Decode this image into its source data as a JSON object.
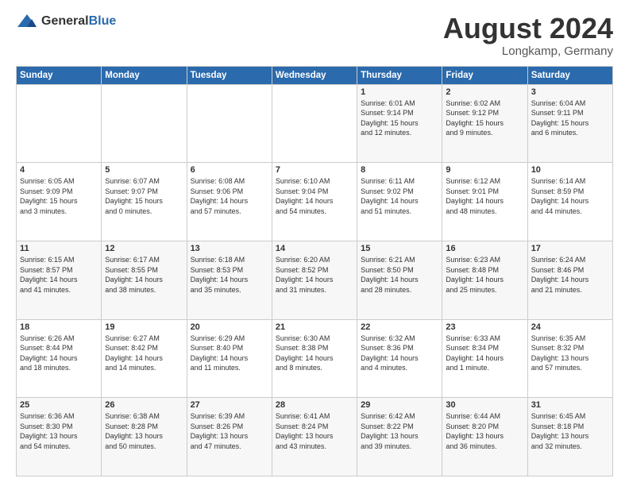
{
  "header": {
    "logo": {
      "general": "General",
      "blue": "Blue"
    },
    "title": "August 2024",
    "location": "Longkamp, Germany"
  },
  "weekdays": [
    "Sunday",
    "Monday",
    "Tuesday",
    "Wednesday",
    "Thursday",
    "Friday",
    "Saturday"
  ],
  "weeks": [
    [
      {
        "day": "",
        "info": ""
      },
      {
        "day": "",
        "info": ""
      },
      {
        "day": "",
        "info": ""
      },
      {
        "day": "",
        "info": ""
      },
      {
        "day": "1",
        "info": "Sunrise: 6:01 AM\nSunset: 9:14 PM\nDaylight: 15 hours\nand 12 minutes."
      },
      {
        "day": "2",
        "info": "Sunrise: 6:02 AM\nSunset: 9:12 PM\nDaylight: 15 hours\nand 9 minutes."
      },
      {
        "day": "3",
        "info": "Sunrise: 6:04 AM\nSunset: 9:11 PM\nDaylight: 15 hours\nand 6 minutes."
      }
    ],
    [
      {
        "day": "4",
        "info": "Sunrise: 6:05 AM\nSunset: 9:09 PM\nDaylight: 15 hours\nand 3 minutes."
      },
      {
        "day": "5",
        "info": "Sunrise: 6:07 AM\nSunset: 9:07 PM\nDaylight: 15 hours\nand 0 minutes."
      },
      {
        "day": "6",
        "info": "Sunrise: 6:08 AM\nSunset: 9:06 PM\nDaylight: 14 hours\nand 57 minutes."
      },
      {
        "day": "7",
        "info": "Sunrise: 6:10 AM\nSunset: 9:04 PM\nDaylight: 14 hours\nand 54 minutes."
      },
      {
        "day": "8",
        "info": "Sunrise: 6:11 AM\nSunset: 9:02 PM\nDaylight: 14 hours\nand 51 minutes."
      },
      {
        "day": "9",
        "info": "Sunrise: 6:12 AM\nSunset: 9:01 PM\nDaylight: 14 hours\nand 48 minutes."
      },
      {
        "day": "10",
        "info": "Sunrise: 6:14 AM\nSunset: 8:59 PM\nDaylight: 14 hours\nand 44 minutes."
      }
    ],
    [
      {
        "day": "11",
        "info": "Sunrise: 6:15 AM\nSunset: 8:57 PM\nDaylight: 14 hours\nand 41 minutes."
      },
      {
        "day": "12",
        "info": "Sunrise: 6:17 AM\nSunset: 8:55 PM\nDaylight: 14 hours\nand 38 minutes."
      },
      {
        "day": "13",
        "info": "Sunrise: 6:18 AM\nSunset: 8:53 PM\nDaylight: 14 hours\nand 35 minutes."
      },
      {
        "day": "14",
        "info": "Sunrise: 6:20 AM\nSunset: 8:52 PM\nDaylight: 14 hours\nand 31 minutes."
      },
      {
        "day": "15",
        "info": "Sunrise: 6:21 AM\nSunset: 8:50 PM\nDaylight: 14 hours\nand 28 minutes."
      },
      {
        "day": "16",
        "info": "Sunrise: 6:23 AM\nSunset: 8:48 PM\nDaylight: 14 hours\nand 25 minutes."
      },
      {
        "day": "17",
        "info": "Sunrise: 6:24 AM\nSunset: 8:46 PM\nDaylight: 14 hours\nand 21 minutes."
      }
    ],
    [
      {
        "day": "18",
        "info": "Sunrise: 6:26 AM\nSunset: 8:44 PM\nDaylight: 14 hours\nand 18 minutes."
      },
      {
        "day": "19",
        "info": "Sunrise: 6:27 AM\nSunset: 8:42 PM\nDaylight: 14 hours\nand 14 minutes."
      },
      {
        "day": "20",
        "info": "Sunrise: 6:29 AM\nSunset: 8:40 PM\nDaylight: 14 hours\nand 11 minutes."
      },
      {
        "day": "21",
        "info": "Sunrise: 6:30 AM\nSunset: 8:38 PM\nDaylight: 14 hours\nand 8 minutes."
      },
      {
        "day": "22",
        "info": "Sunrise: 6:32 AM\nSunset: 8:36 PM\nDaylight: 14 hours\nand 4 minutes."
      },
      {
        "day": "23",
        "info": "Sunrise: 6:33 AM\nSunset: 8:34 PM\nDaylight: 14 hours\nand 1 minute."
      },
      {
        "day": "24",
        "info": "Sunrise: 6:35 AM\nSunset: 8:32 PM\nDaylight: 13 hours\nand 57 minutes."
      }
    ],
    [
      {
        "day": "25",
        "info": "Sunrise: 6:36 AM\nSunset: 8:30 PM\nDaylight: 13 hours\nand 54 minutes."
      },
      {
        "day": "26",
        "info": "Sunrise: 6:38 AM\nSunset: 8:28 PM\nDaylight: 13 hours\nand 50 minutes."
      },
      {
        "day": "27",
        "info": "Sunrise: 6:39 AM\nSunset: 8:26 PM\nDaylight: 13 hours\nand 47 minutes."
      },
      {
        "day": "28",
        "info": "Sunrise: 6:41 AM\nSunset: 8:24 PM\nDaylight: 13 hours\nand 43 minutes."
      },
      {
        "day": "29",
        "info": "Sunrise: 6:42 AM\nSunset: 8:22 PM\nDaylight: 13 hours\nand 39 minutes."
      },
      {
        "day": "30",
        "info": "Sunrise: 6:44 AM\nSunset: 8:20 PM\nDaylight: 13 hours\nand 36 minutes."
      },
      {
        "day": "31",
        "info": "Sunrise: 6:45 AM\nSunset: 8:18 PM\nDaylight: 13 hours\nand 32 minutes."
      }
    ]
  ]
}
